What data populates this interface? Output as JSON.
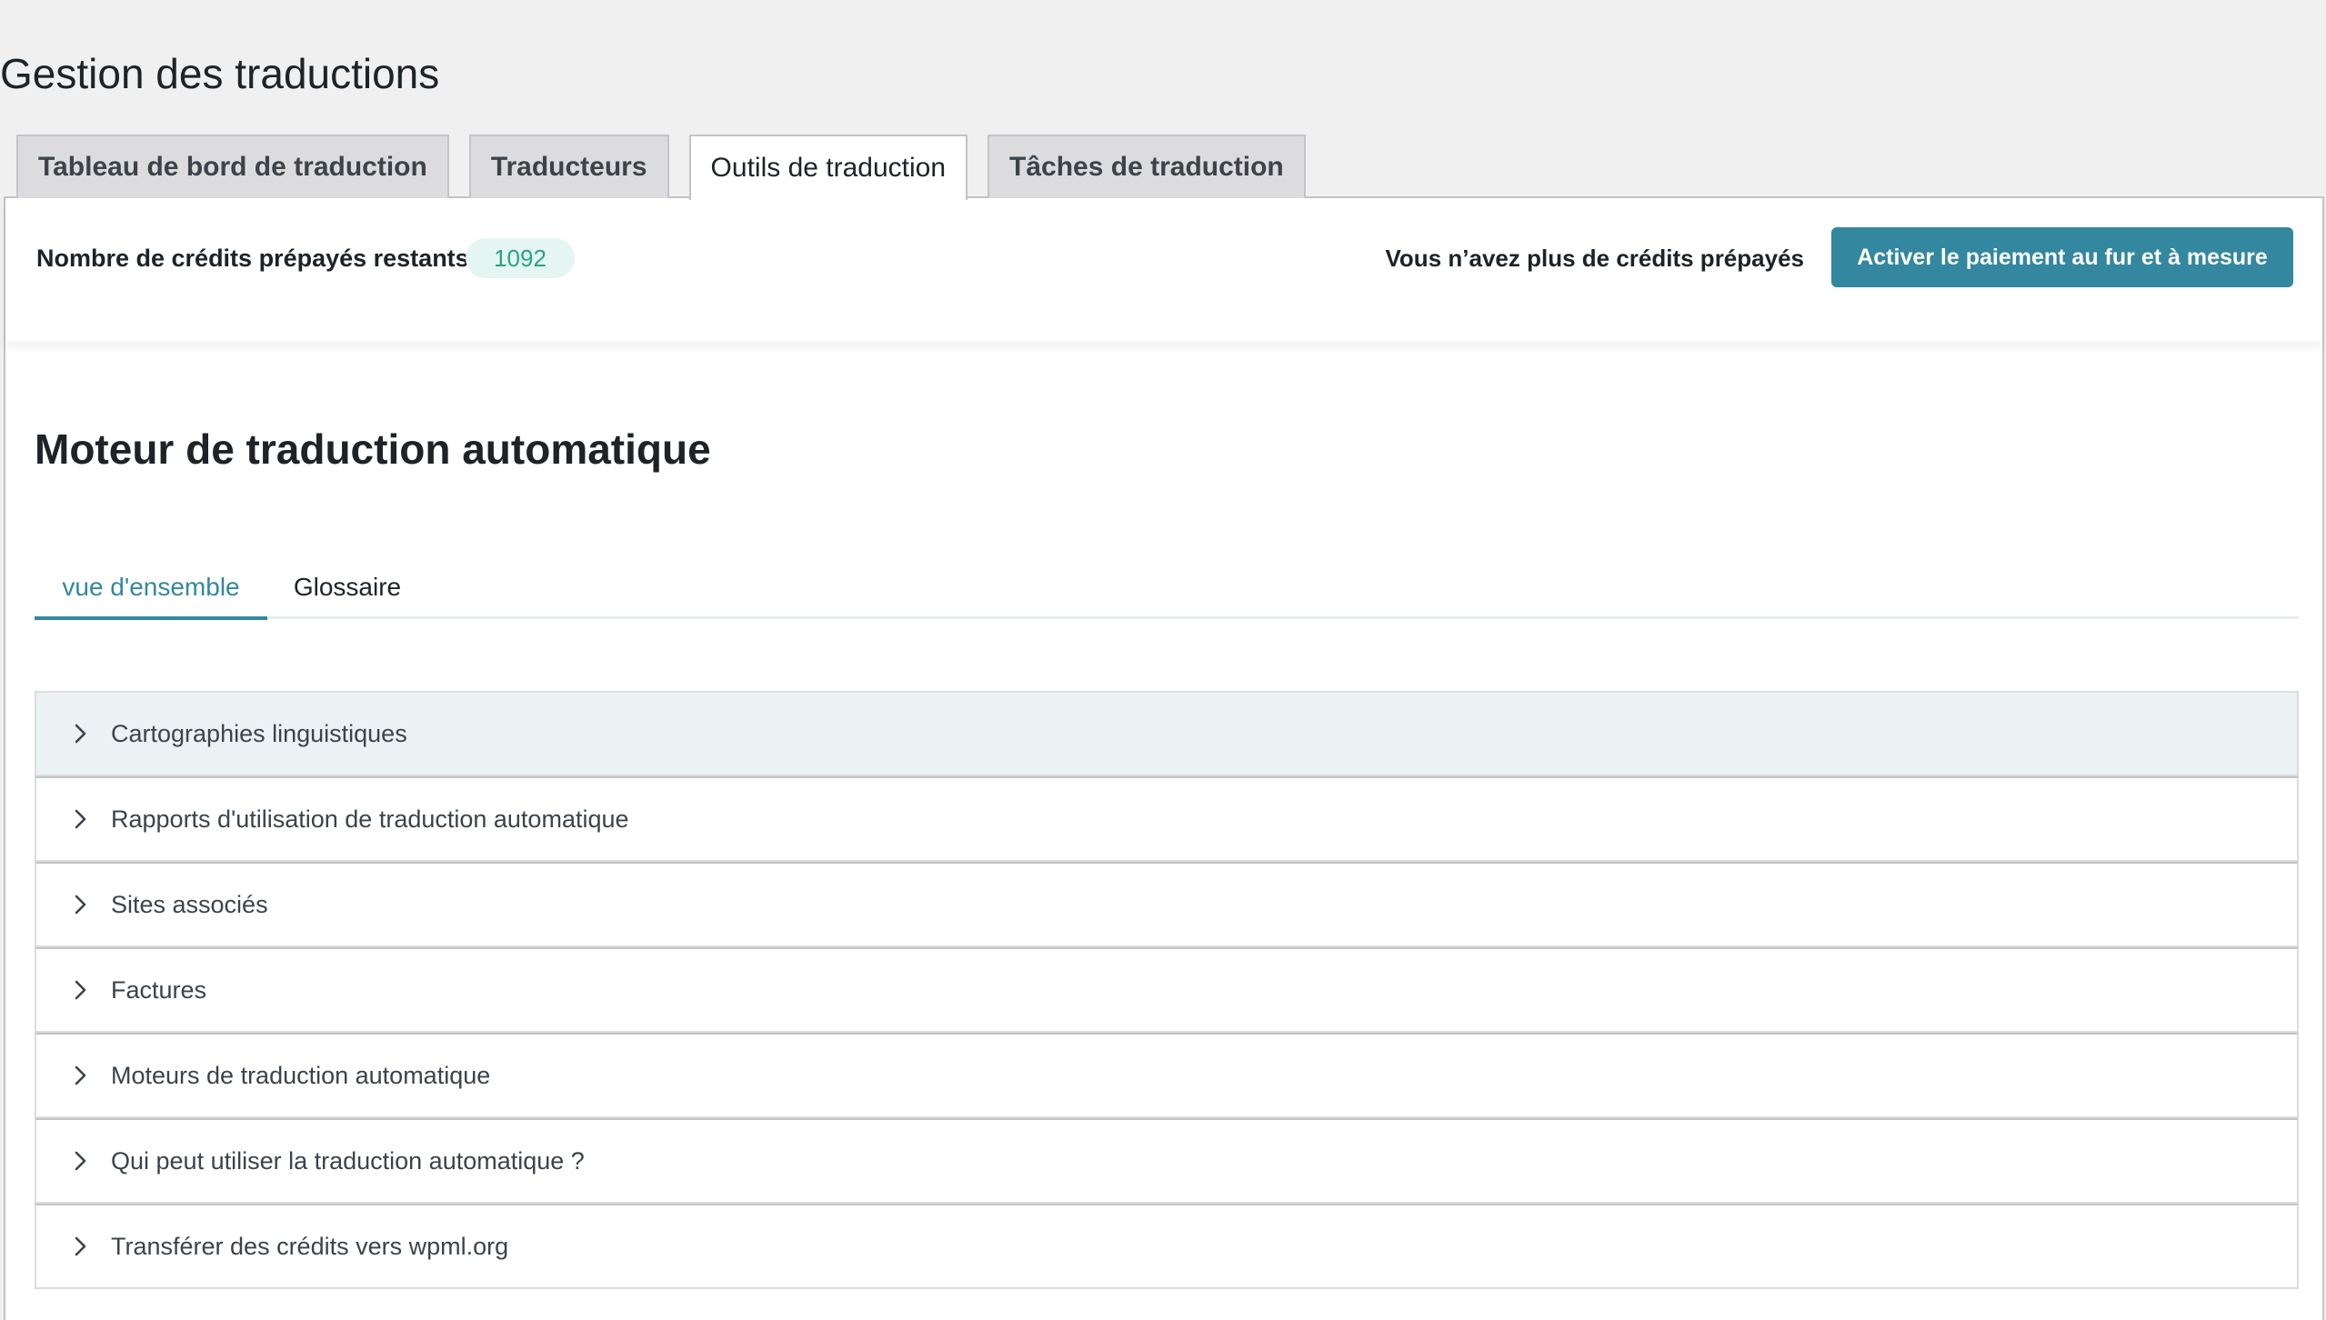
{
  "page": {
    "title": "Gestion des traductions"
  },
  "tabs": [
    {
      "label": "Tableau de bord de traduction",
      "active": false
    },
    {
      "label": "Traducteurs",
      "active": false
    },
    {
      "label": "Outils de traduction",
      "active": true
    },
    {
      "label": "Tâches de traduction",
      "active": false
    }
  ],
  "credits": {
    "label": "Nombre de crédits prépayés restants",
    "count": "1092",
    "no_credits_text": "Vous n’avez plus de crédits prépayés",
    "button_label": "Activer le paiement au fur et à mesure"
  },
  "colors": {
    "accent": "#33879e",
    "badge_bg": "#e5f5f1",
    "badge_text": "#2aa384",
    "highlight_row": "#eaf2f3"
  },
  "section": {
    "title": "Moteur de traduction automatique"
  },
  "subtabs": [
    {
      "label": "vue d'ensemble",
      "active": true
    },
    {
      "label": "Glossaire",
      "active": false
    }
  ],
  "accordion": [
    {
      "label": "Cartographies linguistiques",
      "icon": "chevron-right-icon",
      "highlighted": true
    },
    {
      "label": "Rapports d'utilisation de traduction automatique",
      "icon": "chevron-right-icon",
      "highlighted": false
    },
    {
      "label": "Sites associés",
      "icon": "chevron-right-icon",
      "highlighted": false
    },
    {
      "label": "Factures",
      "icon": "chevron-right-icon",
      "highlighted": false
    },
    {
      "label": "Moteurs de traduction automatique",
      "icon": "chevron-right-icon",
      "highlighted": false
    },
    {
      "label": "Qui peut utiliser la traduction automatique ?",
      "icon": "chevron-right-icon",
      "highlighted": false
    },
    {
      "label": "Transférer des crédits vers wpml.org",
      "icon": "chevron-right-icon",
      "highlighted": false
    }
  ]
}
